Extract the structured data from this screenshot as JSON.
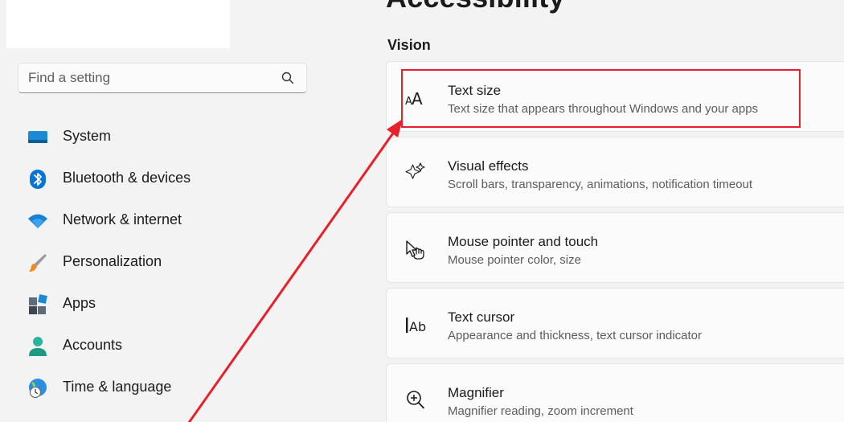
{
  "page": {
    "title": "Accessibility"
  },
  "search": {
    "placeholder": "Find a setting",
    "value": ""
  },
  "sidebar": {
    "items": [
      {
        "label": "System",
        "icon": "monitor-icon"
      },
      {
        "label": "Bluetooth & devices",
        "icon": "bluetooth-icon"
      },
      {
        "label": "Network & internet",
        "icon": "wifi-icon"
      },
      {
        "label": "Personalization",
        "icon": "paintbrush-icon"
      },
      {
        "label": "Apps",
        "icon": "apps-icon"
      },
      {
        "label": "Accounts",
        "icon": "person-icon"
      },
      {
        "label": "Time & language",
        "icon": "globe-clock-icon"
      }
    ]
  },
  "vision": {
    "title": "Vision",
    "cards": [
      {
        "title": "Text size",
        "subtitle": "Text size that appears throughout Windows and your apps",
        "icon": "text-size-icon"
      },
      {
        "title": "Visual effects",
        "subtitle": "Scroll bars, transparency, animations, notification timeout",
        "icon": "sparkle-icon"
      },
      {
        "title": "Mouse pointer and touch",
        "subtitle": "Mouse pointer color, size",
        "icon": "pointer-touch-icon"
      },
      {
        "title": "Text cursor",
        "subtitle": "Appearance and thickness, text cursor indicator",
        "icon": "text-cursor-icon"
      },
      {
        "title": "Magnifier",
        "subtitle": "Magnifier reading, zoom increment",
        "icon": "magnifier-icon"
      }
    ]
  },
  "annotation": {
    "color": "#e8202a",
    "highlight_target": "Text size"
  },
  "colors": {
    "background": "#f3f3f3",
    "card": "#fbfbfb",
    "accent_blue": "#0067c0"
  }
}
